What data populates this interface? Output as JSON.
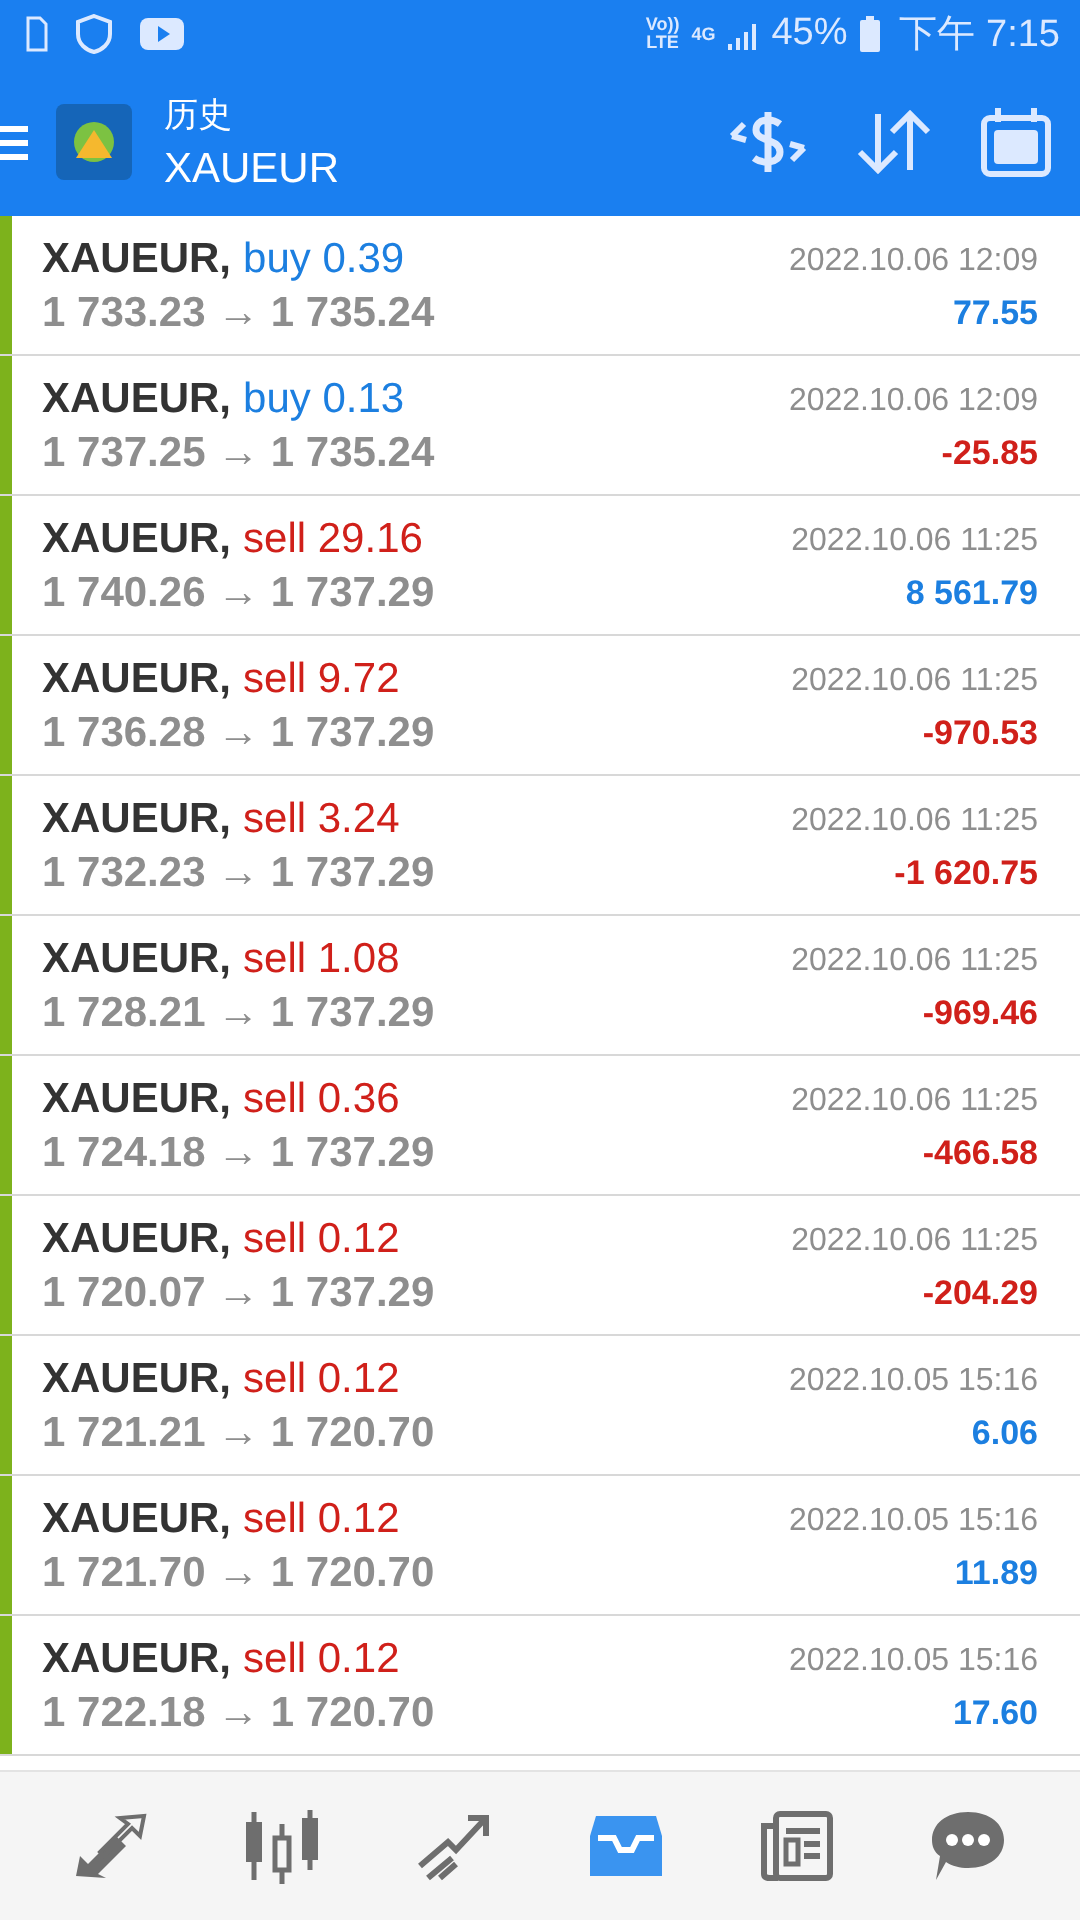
{
  "status_bar": {
    "volte": "Vo))",
    "lte": "LTE",
    "network": "4G",
    "battery": "45%",
    "time": "下午 7:15"
  },
  "header": {
    "title": "历史",
    "subtitle": "XAUEUR"
  },
  "trades": [
    {
      "symbol": "XAUEUR,",
      "kind": "buy",
      "side": "buy",
      "volume": "0.39",
      "prices": "1 733.23 → 1 735.24",
      "time": "2022.10.06 12:09",
      "profit": "77.55",
      "loss": false
    },
    {
      "symbol": "XAUEUR,",
      "kind": "buy",
      "side": "buy",
      "volume": "0.13",
      "prices": "1 737.25 → 1 735.24",
      "time": "2022.10.06 12:09",
      "profit": "-25.85",
      "loss": true
    },
    {
      "symbol": "XAUEUR,",
      "kind": "sell",
      "side": "sell",
      "volume": "29.16",
      "prices": "1 740.26 → 1 737.29",
      "time": "2022.10.06 11:25",
      "profit": "8 561.79",
      "loss": false
    },
    {
      "symbol": "XAUEUR,",
      "kind": "sell",
      "side": "sell",
      "volume": "9.72",
      "prices": "1 736.28 → 1 737.29",
      "time": "2022.10.06 11:25",
      "profit": "-970.53",
      "loss": true
    },
    {
      "symbol": "XAUEUR,",
      "kind": "sell",
      "side": "sell",
      "volume": "3.24",
      "prices": "1 732.23 → 1 737.29",
      "time": "2022.10.06 11:25",
      "profit": "-1 620.75",
      "loss": true
    },
    {
      "symbol": "XAUEUR,",
      "kind": "sell",
      "side": "sell",
      "volume": "1.08",
      "prices": "1 728.21 → 1 737.29",
      "time": "2022.10.06 11:25",
      "profit": "-969.46",
      "loss": true
    },
    {
      "symbol": "XAUEUR,",
      "kind": "sell",
      "side": "sell",
      "volume": "0.36",
      "prices": "1 724.18 → 1 737.29",
      "time": "2022.10.06 11:25",
      "profit": "-466.58",
      "loss": true
    },
    {
      "symbol": "XAUEUR,",
      "kind": "sell",
      "side": "sell",
      "volume": "0.12",
      "prices": "1 720.07 → 1 737.29",
      "time": "2022.10.06 11:25",
      "profit": "-204.29",
      "loss": true
    },
    {
      "symbol": "XAUEUR,",
      "kind": "sell",
      "side": "sell",
      "volume": "0.12",
      "prices": "1 721.21 → 1 720.70",
      "time": "2022.10.05 15:16",
      "profit": "6.06",
      "loss": false
    },
    {
      "symbol": "XAUEUR,",
      "kind": "sell",
      "side": "sell",
      "volume": "0.12",
      "prices": "1 721.70 → 1 720.70",
      "time": "2022.10.05 15:16",
      "profit": "11.89",
      "loss": false
    },
    {
      "symbol": "XAUEUR,",
      "kind": "sell",
      "side": "sell",
      "volume": "0.12",
      "prices": "1 722.18 → 1 720.70",
      "time": "2022.10.05 15:16",
      "profit": "17.60",
      "loss": false
    }
  ],
  "nav": [
    {
      "kind": "quotes",
      "selected": false
    },
    {
      "kind": "chart",
      "selected": false
    },
    {
      "kind": "trade",
      "selected": false
    },
    {
      "kind": "history",
      "selected": true
    },
    {
      "kind": "news",
      "selected": false
    },
    {
      "kind": "messages",
      "selected": false
    }
  ]
}
